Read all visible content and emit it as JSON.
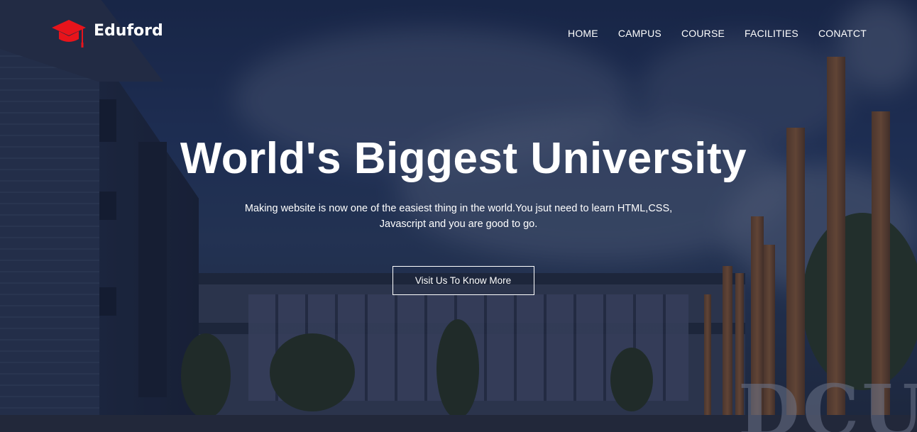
{
  "brand": {
    "name": "Eduford",
    "logo_icon": "graduation-cap-icon",
    "logo_color": "#e8141b"
  },
  "nav": {
    "items": [
      {
        "label": "HOME"
      },
      {
        "label": "CAMPUS"
      },
      {
        "label": "COURSE"
      },
      {
        "label": "FACILITIES"
      },
      {
        "label": "CONATCT"
      }
    ]
  },
  "hero": {
    "title": "World's Biggest University",
    "subtitle": "Making website is now one of the easiest thing in the world.You jsut need to learn HTML,CSS, Javascript and you are good to go.",
    "cta_label": "Visit Us To Know More",
    "background_sign_text": "DCU"
  },
  "colors": {
    "text": "#ffffff",
    "overlay": "#14203c"
  }
}
